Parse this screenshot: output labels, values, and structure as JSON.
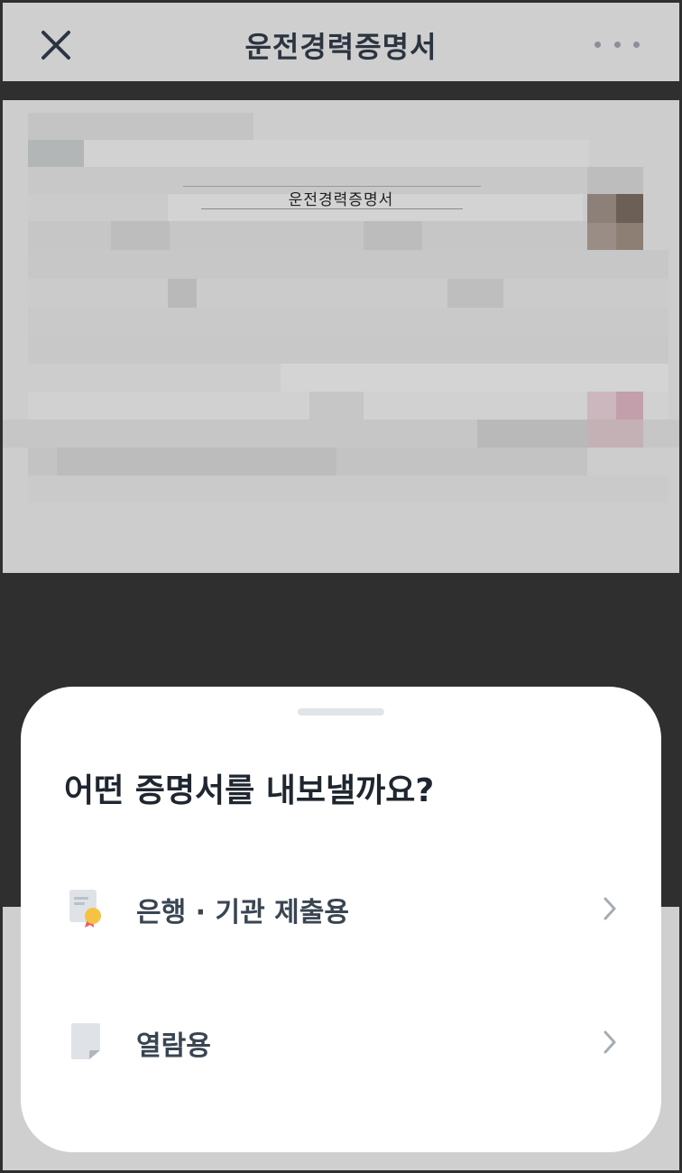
{
  "header": {
    "title": "운전경력증명서",
    "close_icon": "close-icon",
    "more_icon": "more-horizontal-icon"
  },
  "document_preview": {
    "title": "운전경력증명서"
  },
  "sheet": {
    "title": "어떤 증명서를 내보낼까요?",
    "options": [
      {
        "label": "은행 · 기관 제출용",
        "icon": "certificate-icon"
      },
      {
        "label": "열람용",
        "icon": "document-icon"
      }
    ]
  }
}
